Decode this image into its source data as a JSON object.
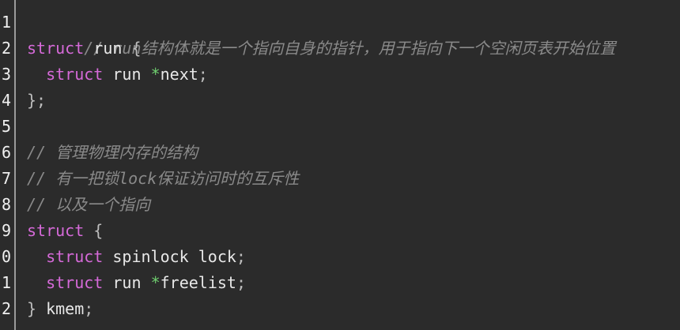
{
  "editor": {
    "line_numbers": [
      "1",
      "2",
      "3",
      "4",
      "5",
      "6",
      "7",
      "8",
      "9",
      "0",
      "1",
      "2"
    ],
    "lines": [
      {
        "comment": "// run结构体就是一个指向自身的指针，用于指向下一个空闲页表开始位置"
      },
      {
        "kw": "struct",
        "rest": " run ",
        "punct": "{"
      },
      {
        "indent": "  ",
        "kw": "struct",
        "rest": " run ",
        "op": "*",
        "rest2": "next",
        "punct": ";"
      },
      {
        "punct": "};"
      },
      {
        "empty": ""
      },
      {
        "comment": "// 管理物理内存的结构"
      },
      {
        "comment": "// 有一把锁lock保证访问时的互斥性"
      },
      {
        "comment": "// 以及一个指向"
      },
      {
        "kw": "struct",
        "punct": " {"
      },
      {
        "indent": "  ",
        "kw": "struct",
        "rest": " spinlock lock",
        "punct": ";"
      },
      {
        "indent": "  ",
        "kw": "struct",
        "rest": " run ",
        "op": "*",
        "rest2": "freelist",
        "punct": ";"
      },
      {
        "punct": "}",
        "rest": " kmem",
        "punct2": ";"
      }
    ]
  },
  "colors": {
    "background": "#2b2b2b",
    "keyword": "#d66ad9",
    "comment": "#8a8a8a",
    "identifier": "#e8e8e8",
    "operator": "#6fcf6f"
  }
}
